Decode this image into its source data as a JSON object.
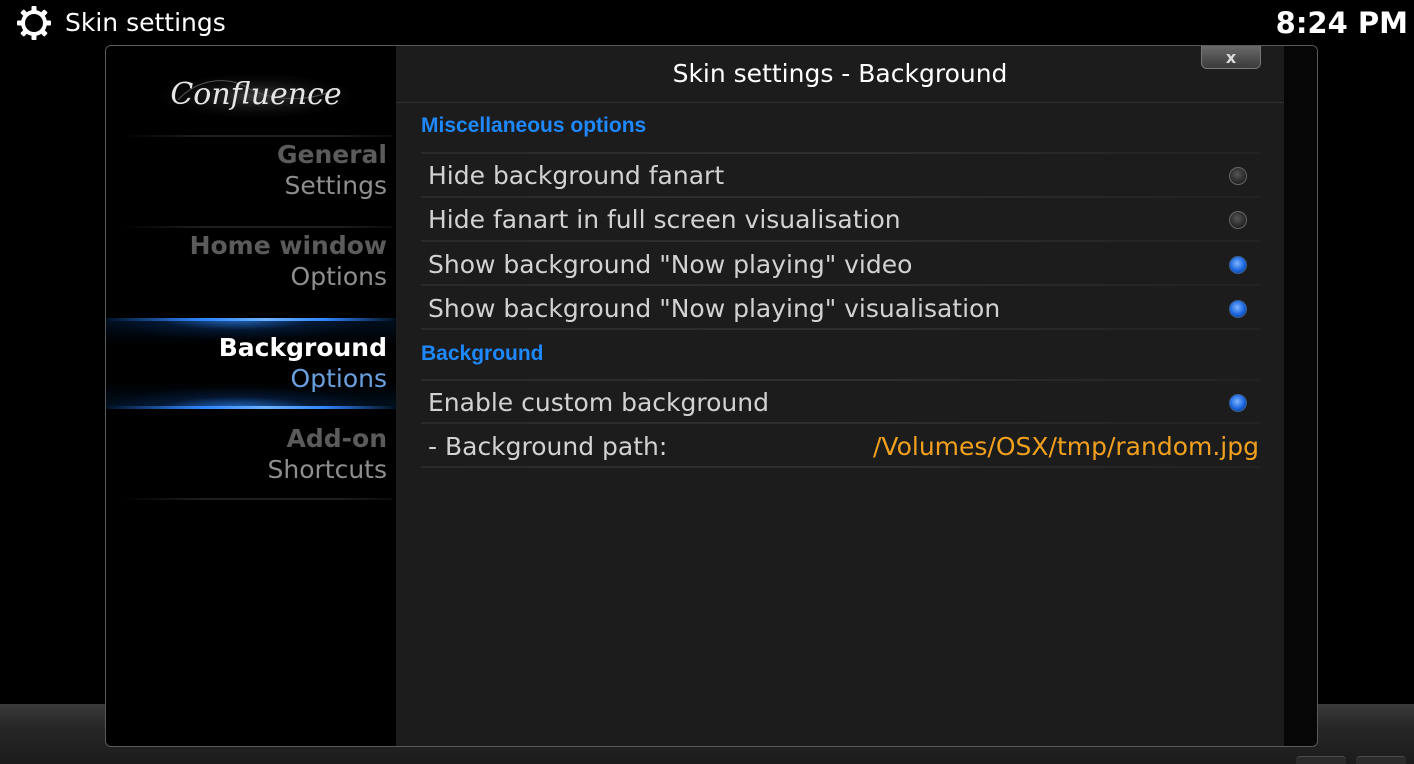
{
  "header": {
    "title": "Skin settings",
    "time": "8:24 PM",
    "icon": "gear-icon"
  },
  "sidebar": {
    "logo_text": "Confluence",
    "items": [
      {
        "line1": "General",
        "line2": "Settings",
        "active": false
      },
      {
        "line1": "Home window",
        "line2": "Options",
        "active": false
      },
      {
        "line1": "Background",
        "line2": "Options",
        "active": true
      },
      {
        "line1": "Add-on",
        "line2": "Shortcuts",
        "active": false
      }
    ]
  },
  "dialog": {
    "title": "Skin settings - Background",
    "close_label": "x"
  },
  "sections": [
    {
      "header": "Miscellaneous options",
      "rows": [
        {
          "label": "Hide background fanart",
          "checked": false
        },
        {
          "label": "Hide fanart in full screen visualisation",
          "checked": false
        },
        {
          "label": "Show background \"Now playing\" video",
          "checked": true
        },
        {
          "label": "Show background \"Now playing\" visualisation",
          "checked": true
        }
      ]
    },
    {
      "header": "Background",
      "rows": [
        {
          "label": "Enable custom background",
          "checked": true
        },
        {
          "label": "- Background path:",
          "value": "/Volumes/OSX/tmp/random.jpg"
        }
      ]
    }
  ],
  "colors": {
    "accent": "#1e88ff",
    "value": "#f0a01e",
    "radio_on": "#1a66e0",
    "radio_off": "#444444"
  }
}
